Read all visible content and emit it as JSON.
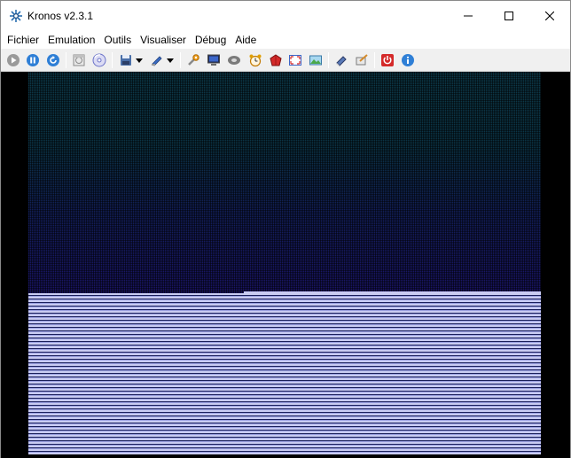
{
  "window": {
    "title": "Kronos v2.3.1"
  },
  "menu": [
    "Fichier",
    "Emulation",
    "Outils",
    "Visualiser",
    "Débug",
    "Aide"
  ],
  "toolbar": {
    "buttons": [
      {
        "icon": "play-icon"
      },
      {
        "icon": "pause-icon"
      },
      {
        "icon": "reset-icon"
      },
      {
        "icon": "open-iso-icon"
      },
      {
        "icon": "open-cd-icon"
      },
      {
        "icon": "save-state-icon"
      },
      {
        "icon": "load-state-icon"
      },
      {
        "icon": "settings-icon"
      },
      {
        "icon": "monitor-icon"
      },
      {
        "icon": "cd-drive-icon"
      },
      {
        "icon": "alarm-clock-icon"
      },
      {
        "icon": "cheats-icon"
      },
      {
        "icon": "fullscreen-icon"
      },
      {
        "icon": "screenshot-icon"
      },
      {
        "icon": "eraser-icon"
      },
      {
        "icon": "frame-icon"
      },
      {
        "icon": "quit-icon"
      },
      {
        "icon": "about-icon"
      }
    ]
  },
  "colors": {
    "display_bg": "#000000",
    "screen_top": "#0b3346",
    "screen_bottom": "#c9ccf2",
    "toolbar_bg": "#f0f0f0"
  }
}
